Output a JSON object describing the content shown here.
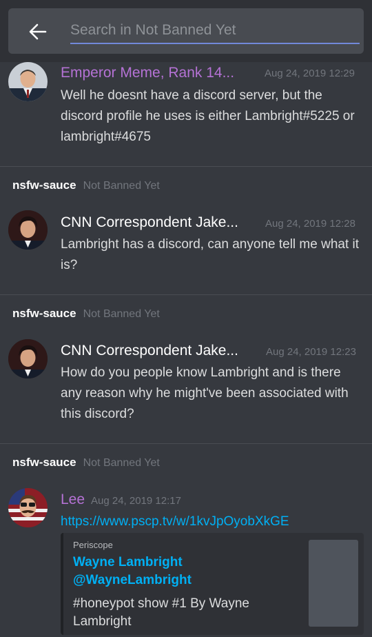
{
  "search": {
    "placeholder": "Search in Not Banned Yet"
  },
  "messages": [
    {
      "author": "Emperor Meme, Rank 14...",
      "author_color": "#b572d5",
      "timestamp": "Aug 24, 2019 12:29",
      "text": "Well he doesnt have a discord server, but the discord profile he uses is either Lambright#5225 or lambright#4675",
      "avatar": "man-in-suit-avatar"
    },
    {
      "channel": "nsfw-sauce",
      "guild": "Not Banned Yet",
      "author": "CNN Correspondent Jake...",
      "author_color": "#ffffff",
      "timestamp": "Aug 24, 2019 12:28",
      "text": "Lambright has a discord, can anyone tell me what it is?",
      "avatar": "dark-haired-man-avatar"
    },
    {
      "channel": "nsfw-sauce",
      "guild": "Not Banned Yet",
      "author": "CNN Correspondent Jake...",
      "author_color": "#ffffff",
      "timestamp": "Aug 24, 2019 12:23",
      "text": "How do you people know Lambright and is there any reason why he might've been associated with this discord?",
      "avatar": "dark-haired-man-avatar"
    },
    {
      "channel": "nsfw-sauce",
      "guild": "Not Banned Yet",
      "author": "Lee",
      "author_color": "#b572d5",
      "timestamp": "Aug 24, 2019 12:17",
      "link": "https://www.pscp.tv/w/1kvJpOyobXkGE",
      "avatar": "mustache-man-avatar",
      "embed": {
        "provider": "Periscope",
        "author_line1": "Wayne Lambright",
        "author_line2": "@WayneLambright",
        "description": "#honeypot show #1 By Wayne Lambright"
      }
    }
  ]
}
